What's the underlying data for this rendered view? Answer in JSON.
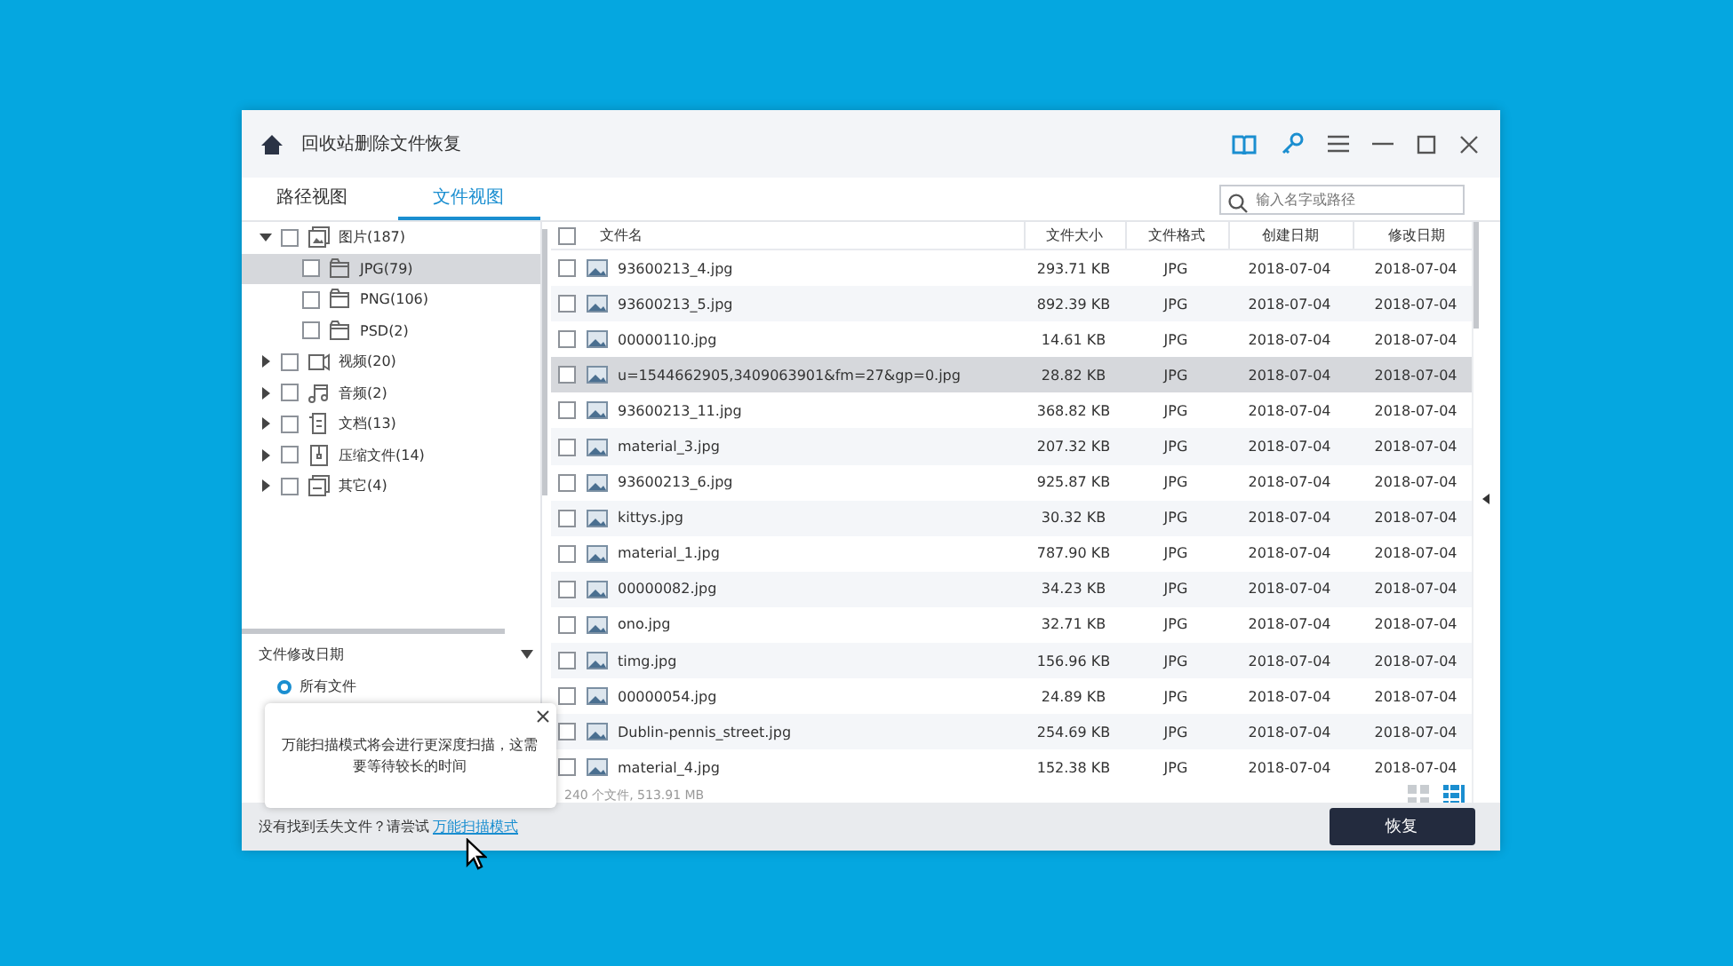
{
  "window": {
    "title": "回收站删除文件恢复"
  },
  "tabs": [
    {
      "label": "路径视图",
      "selected": false
    },
    {
      "label": "文件视图",
      "selected": true
    }
  ],
  "search": {
    "placeholder": "输入名字或路径"
  },
  "tree": [
    {
      "label": "图片(187)",
      "kind": "image",
      "expanded": true,
      "checked": false,
      "selected": false,
      "children": [
        {
          "label": "JPG(79)",
          "kind": "folder",
          "checked": false,
          "selected": true
        },
        {
          "label": "PNG(106)",
          "kind": "folder",
          "checked": false,
          "selected": false
        },
        {
          "label": "PSD(2)",
          "kind": "folder",
          "checked": false,
          "selected": false
        }
      ]
    },
    {
      "label": "视频(20)",
      "kind": "video",
      "expanded": false,
      "checked": false,
      "selected": false
    },
    {
      "label": "音频(2)",
      "kind": "music",
      "expanded": false,
      "checked": false,
      "selected": false
    },
    {
      "label": "文档(13)",
      "kind": "document",
      "expanded": false,
      "checked": false,
      "selected": false
    },
    {
      "label": "压缩文件(14)",
      "kind": "archive",
      "expanded": false,
      "checked": false,
      "selected": false
    },
    {
      "label": "其它(4)",
      "kind": "other",
      "expanded": false,
      "checked": false,
      "selected": false
    }
  ],
  "filter": {
    "title": "文件修改日期",
    "options": [
      {
        "label": "所有文件",
        "selected": true
      }
    ]
  },
  "table": {
    "all_checked": false,
    "columns": [
      "文件名",
      "文件大小",
      "文件格式",
      "创建日期",
      "修改日期"
    ],
    "rows": [
      {
        "name": "93600213_4.jpg",
        "size": "293.71 KB",
        "format": "JPG",
        "created": "2018-07-04",
        "modified": "2018-07-04",
        "checked": false,
        "selected": false
      },
      {
        "name": "93600213_5.jpg",
        "size": "892.39 KB",
        "format": "JPG",
        "created": "2018-07-04",
        "modified": "2018-07-04",
        "checked": false,
        "selected": false
      },
      {
        "name": "00000110.jpg",
        "size": "14.61 KB",
        "format": "JPG",
        "created": "2018-07-04",
        "modified": "2018-07-04",
        "checked": false,
        "selected": false
      },
      {
        "name": "u=1544662905,3409063901&fm=27&gp=0.jpg",
        "size": "28.82 KB",
        "format": "JPG",
        "created": "2018-07-04",
        "modified": "2018-07-04",
        "checked": false,
        "selected": true
      },
      {
        "name": "93600213_11.jpg",
        "size": "368.82 KB",
        "format": "JPG",
        "created": "2018-07-04",
        "modified": "2018-07-04",
        "checked": false,
        "selected": false
      },
      {
        "name": "material_3.jpg",
        "size": "207.32 KB",
        "format": "JPG",
        "created": "2018-07-04",
        "modified": "2018-07-04",
        "checked": false,
        "selected": false
      },
      {
        "name": "93600213_6.jpg",
        "size": "925.87 KB",
        "format": "JPG",
        "created": "2018-07-04",
        "modified": "2018-07-04",
        "checked": false,
        "selected": false
      },
      {
        "name": "kittys.jpg",
        "size": "30.32 KB",
        "format": "JPG",
        "created": "2018-07-04",
        "modified": "2018-07-04",
        "checked": false,
        "selected": false
      },
      {
        "name": "material_1.jpg",
        "size": "787.90 KB",
        "format": "JPG",
        "created": "2018-07-04",
        "modified": "2018-07-04",
        "checked": false,
        "selected": false
      },
      {
        "name": "00000082.jpg",
        "size": "34.23 KB",
        "format": "JPG",
        "created": "2018-07-04",
        "modified": "2018-07-04",
        "checked": false,
        "selected": false
      },
      {
        "name": "ono.jpg",
        "size": "32.71 KB",
        "format": "JPG",
        "created": "2018-07-04",
        "modified": "2018-07-04",
        "checked": false,
        "selected": false
      },
      {
        "name": "timg.jpg",
        "size": "156.96 KB",
        "format": "JPG",
        "created": "2018-07-04",
        "modified": "2018-07-04",
        "checked": false,
        "selected": false
      },
      {
        "name": "00000054.jpg",
        "size": "24.89 KB",
        "format": "JPG",
        "created": "2018-07-04",
        "modified": "2018-07-04",
        "checked": false,
        "selected": false
      },
      {
        "name": "Dublin-pennis_street.jpg",
        "size": "254.69 KB",
        "format": "JPG",
        "created": "2018-07-04",
        "modified": "2018-07-04",
        "checked": false,
        "selected": false
      },
      {
        "name": "material_4.jpg",
        "size": "152.38 KB",
        "format": "JPG",
        "created": "2018-07-04",
        "modified": "2018-07-04",
        "checked": false,
        "selected": false
      }
    ]
  },
  "status": "240 个文件, 513.91 MB",
  "views": [
    {
      "kind": "grid",
      "selected": false
    },
    {
      "kind": "list",
      "selected": true
    }
  ],
  "tooltip": {
    "text": "万能扫描模式将会进行更深度扫描，这需要等待较长的时间"
  },
  "footer": {
    "prompt": "没有找到丢失文件？请尝试",
    "link": "万能扫描模式",
    "button": "恢复"
  }
}
